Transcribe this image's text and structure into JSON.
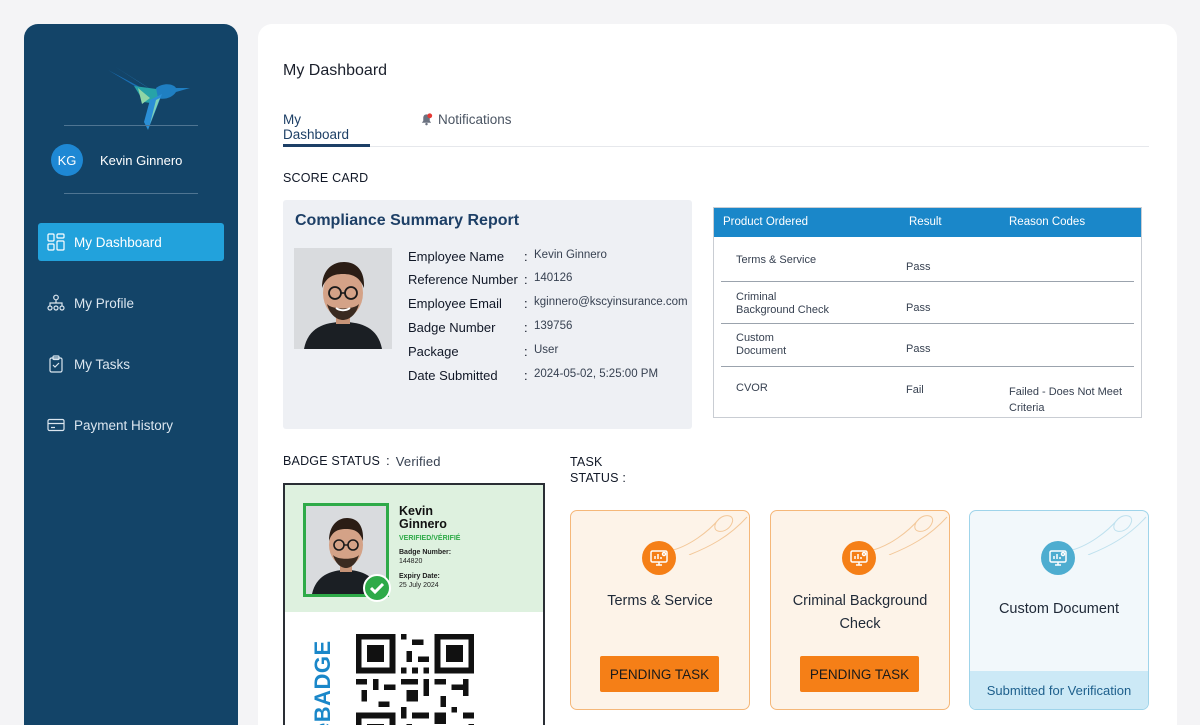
{
  "user": {
    "initials": "KG",
    "name": "Kevin Ginnero"
  },
  "nav": [
    {
      "label": "My Dashboard",
      "icon": "dashboard-icon",
      "active": true
    },
    {
      "label": "My Profile",
      "icon": "org-chart-icon",
      "active": false
    },
    {
      "label": "My Tasks",
      "icon": "clipboard-icon",
      "active": false
    },
    {
      "label": "Payment History",
      "icon": "credit-card-icon",
      "active": false
    }
  ],
  "page": {
    "title": "My Dashboard"
  },
  "tabs": {
    "dashboard": "My Dashboard",
    "notifications": "Notifications"
  },
  "scorecard": {
    "label": "SCORE CARD",
    "title": "Compliance Summary Report",
    "fields": {
      "employee_name": {
        "key": "Employee Name",
        "value": "Kevin Ginnero"
      },
      "reference_number": {
        "key": "Reference Number",
        "value": "140126"
      },
      "employee_email": {
        "key": "Employee Email",
        "value": "kginnero@kscyinsurance.com"
      },
      "badge_number": {
        "key": "Badge Number",
        "value": "139756"
      },
      "package": {
        "key": "Package",
        "value": "User"
      },
      "date_submitted": {
        "key": "Date Submitted",
        "value": "2024-05-02, 5:25:00 PM"
      }
    }
  },
  "results": {
    "headers": [
      "Product Ordered",
      "Result",
      "Reason Codes"
    ],
    "rows": [
      {
        "product": "Terms & Service",
        "result": "Pass",
        "reason": ""
      },
      {
        "product": "Criminal\nBackground Check",
        "result": "Pass",
        "reason": ""
      },
      {
        "product": "Custom\nDocument",
        "result": "Pass",
        "reason": ""
      },
      {
        "product": "CVOR",
        "result": "Fail",
        "reason": "Failed - Does Not Meet\nCriteria"
      }
    ]
  },
  "badge": {
    "status_label": "BADGE STATUS",
    "status_value": "Verified",
    "name": "Kevin\nGinnero",
    "verified": "VERIFIED/VÉRIFIÉ",
    "number_label": "Badge Number:",
    "number": "144820",
    "expiry_label": "Expiry Date:",
    "expiry": "25 July 2024",
    "brand": "eBADGE"
  },
  "tasks": {
    "label": "TASK\nSTATUS :",
    "items": [
      {
        "title": "Terms & Service",
        "status": "PENDING TASK",
        "state": "pending"
      },
      {
        "title": "Criminal Background\nCheck",
        "status": "PENDING TASK",
        "state": "pending"
      },
      {
        "title": "Custom Document",
        "status": "Submitted for Verification",
        "state": "submitted"
      }
    ]
  },
  "colors": {
    "sidebar": "#134468",
    "active_nav": "#22a2dc",
    "table_header": "#1a87c9",
    "pending": "#f57f17",
    "verified_green": "#2eaa48"
  }
}
